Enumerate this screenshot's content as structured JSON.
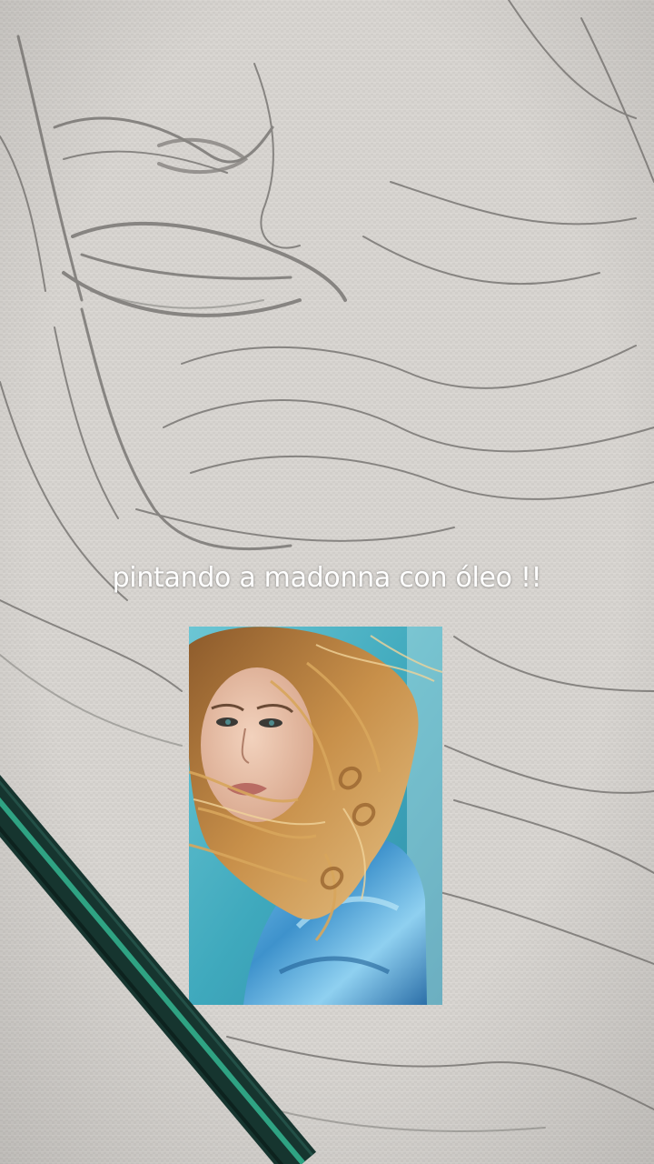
{
  "caption": {
    "text": "pintando a madonna con óleo !!",
    "color": "#ffffff"
  },
  "scene": {
    "background": "canvas-texture-with-pencil-sketch",
    "reference_photo": "portrait-photo-blue-satin-curly-hair",
    "tool": "green-pencil"
  },
  "colors": {
    "canvas": "#d6d3cf",
    "sketch_line": "#6d6a67",
    "photo_background": "#4fb4c4",
    "satin_blue": "#3f8fc4",
    "hair": "#b8823e",
    "pencil_body": "#16352f",
    "pencil_stripe": "#2fa383"
  }
}
